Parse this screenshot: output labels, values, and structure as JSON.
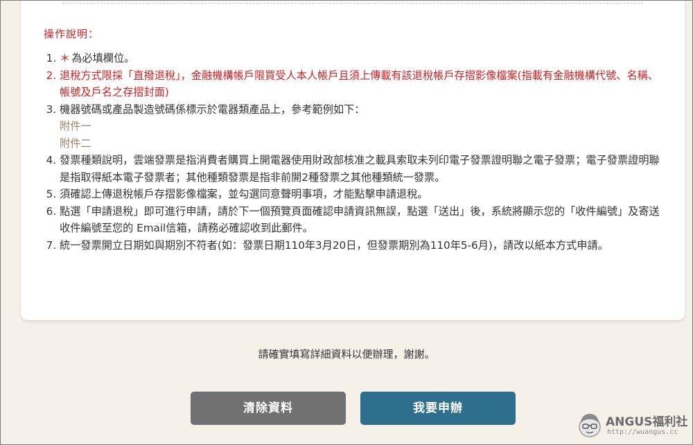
{
  "notes": {
    "title": "操作說明：",
    "items": [
      {
        "star": "＊",
        "text": "為必填欄位。"
      },
      {
        "text": "退稅方式限採「直撥退稅」，金融機構帳戶限買受人本人帳戶且須上傳載有該退稅帳戶存摺影像檔案(指載有金融機構代號、名稱、帳號及戶名之存摺封面)"
      },
      {
        "text": "機器號碼或產品製造號碼係標示於電器類產品上，參考範例如下：",
        "links": [
          "附件一",
          "附件二"
        ]
      },
      {
        "text": "發票種類說明，雲端發票是指消費者購買上開電器使用財政部核准之載具索取未列印電子發票證明聯之電子發票；電子發票證明聯是指取得紙本電子發票者；其他種類發票是指非前開2種發票之其他種類統一發票。"
      },
      {
        "text": "須確認上傳退稅帳戶存摺影像檔案，並勾選同意聲明事項，才能點擊申請退稅。"
      },
      {
        "text": "點選「申請退稅」即可進行申請，請於下一個預覽頁面確認申請資訊無誤，點選「送出」後，系統將顯示您的「收件編號」及寄送收件編號至您的 Email信箱，請務必確認收到此郵件。"
      },
      {
        "text": "統一發票開立日期如與期別不符者(如：發票日期110年3月20日，但發票期別為110年5-6月)，請改以紙本方式申請。"
      }
    ]
  },
  "footer": {
    "message": "請確實填寫詳細資料以便辦理，謝謝。",
    "clear_label": "清除資料",
    "apply_label": "我要申辦"
  },
  "watermark": {
    "name": "ANGUS福利社",
    "url": "http://wuangus.cc"
  },
  "colors": {
    "page_bg": "#f5f0e8",
    "alert_red": "#d81e1e",
    "link_brown": "#9b8266",
    "clear_button": "#717171",
    "apply_button": "#2e6f8e"
  }
}
